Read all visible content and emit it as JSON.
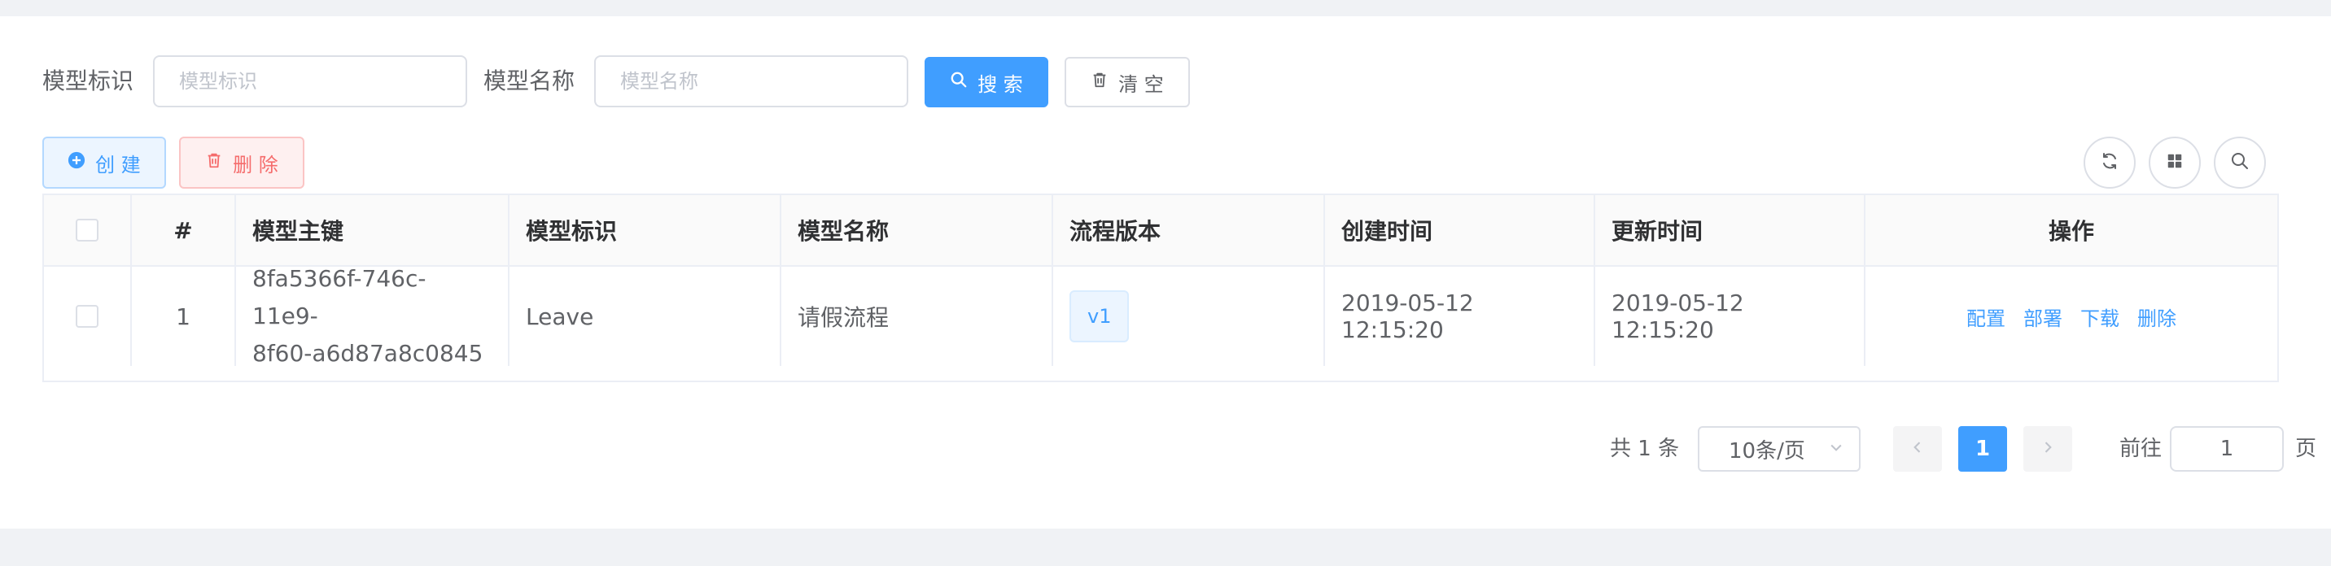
{
  "filters": {
    "model_key_label": "模型标识",
    "model_key_placeholder": "模型标识",
    "model_name_label": "模型名称",
    "model_name_placeholder": "模型名称",
    "search_label": "搜 索",
    "clear_label": "清 空"
  },
  "toolbar": {
    "create_label": "创 建",
    "delete_label": "删 除"
  },
  "table": {
    "headers": [
      "#",
      "模型主键",
      "模型标识",
      "模型名称",
      "流程版本",
      "创建时间",
      "更新时间",
      "操作"
    ],
    "rows": [
      {
        "index": "1",
        "id_line1": "8fa5366f-746c-11e9-",
        "id_line2": "8f60-a6d87a8c0845",
        "key": "Leave",
        "name": "请假流程",
        "version": "v1",
        "created": "2019-05-12 12:15:20",
        "updated": "2019-05-12 12:15:20",
        "actions": [
          "配置",
          "部署",
          "下载",
          "删除"
        ]
      }
    ]
  },
  "pagination": {
    "total_text": "共 1 条",
    "page_size": "10条/页",
    "current_page": "1",
    "goto_label": "前往",
    "goto_value": "1",
    "page_suffix": "页"
  },
  "icons": {
    "search": "search-icon",
    "delete": "trash-icon",
    "create": "plus-circle-icon",
    "refresh": "refresh-icon",
    "columns": "grid-icon",
    "toggle_search": "search-icon"
  },
  "colors": {
    "primary": "#409eff",
    "danger": "#f56c6c",
    "background": "#f0f2f5",
    "border": "#dcdfe6"
  }
}
